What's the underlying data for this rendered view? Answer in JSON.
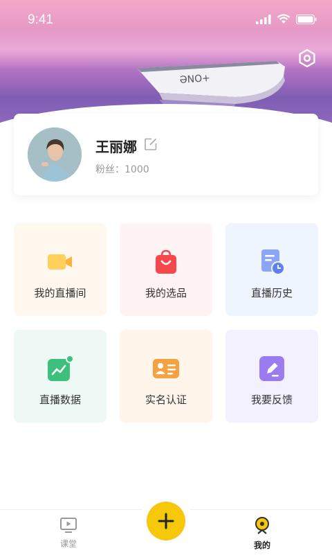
{
  "status_bar": {
    "time": "9:41"
  },
  "profile": {
    "name": "王丽娜",
    "fans_text": "粉丝：1000"
  },
  "grid": [
    {
      "label": "我的直播间",
      "icon": "video-camera-icon",
      "bg": "#fff8ef",
      "color": "#ffc845"
    },
    {
      "label": "我的选品",
      "icon": "shopping-bag-icon",
      "bg": "#fff3f3",
      "color": "#f5484d"
    },
    {
      "label": "直播历史",
      "icon": "history-icon",
      "bg": "#eff5ff",
      "color": "#6b8bf0"
    },
    {
      "label": "直播数据",
      "icon": "data-chart-icon",
      "bg": "#eef8f4",
      "color": "#3dbf7e"
    },
    {
      "label": "实名认证",
      "icon": "id-card-icon",
      "bg": "#fff5ea",
      "color": "#f5a243"
    },
    {
      "label": "我要反馈",
      "icon": "feedback-edit-icon",
      "bg": "#f4f1ff",
      "color": "#9a7cf0"
    }
  ],
  "bottom_nav": {
    "left_label": "课堂",
    "right_label": "我的"
  },
  "colors": {
    "accent": "#f7c70a"
  }
}
